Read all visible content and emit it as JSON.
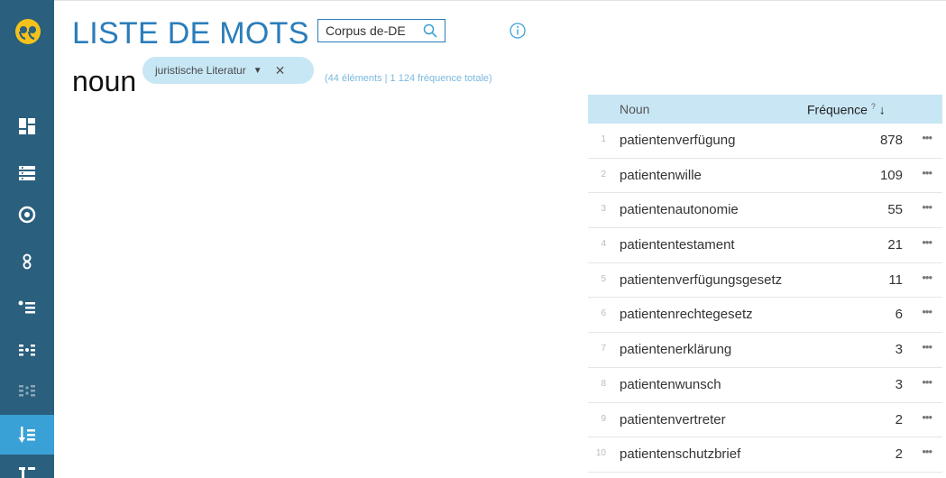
{
  "app": {
    "title": "LISTE DE MOTS"
  },
  "corpus": {
    "value": "Corpus de-DE"
  },
  "query": {
    "attribute": "noun",
    "filter_chip": "juristische Literatur",
    "summary": "(44 éléments | 1 124 fréquence totale)"
  },
  "sidebar": {
    "items": [
      {
        "icon": "dashboard-icon"
      },
      {
        "icon": "list-icon"
      },
      {
        "icon": "target-icon"
      },
      {
        "icon": "concordance-icon"
      },
      {
        "icon": "bullet-list-icon"
      },
      {
        "icon": "ngram-icon"
      },
      {
        "icon": "keywords-icon"
      },
      {
        "icon": "wordlist-icon",
        "active": true
      },
      {
        "icon": "more-icon"
      }
    ]
  },
  "table": {
    "headers": {
      "noun": "Noun",
      "frequency": "Fréquence",
      "frequency_help": "?",
      "sort": "↓"
    },
    "rows": [
      {
        "n": "1",
        "word": "patientenverfügung",
        "freq": "878"
      },
      {
        "n": "2",
        "word": "patientenwille",
        "freq": "109"
      },
      {
        "n": "3",
        "word": "patientenautonomie",
        "freq": "55"
      },
      {
        "n": "4",
        "word": "patiententestament",
        "freq": "21"
      },
      {
        "n": "5",
        "word": "patientenverfügungsgesetz",
        "freq": "11"
      },
      {
        "n": "6",
        "word": "patientenrechtegesetz",
        "freq": "6"
      },
      {
        "n": "7",
        "word": "patientenerklärung",
        "freq": "3"
      },
      {
        "n": "8",
        "word": "patientenwunsch",
        "freq": "3"
      },
      {
        "n": "9",
        "word": "patientenvertreter",
        "freq": "2"
      },
      {
        "n": "10",
        "word": "patientenschutzbrief",
        "freq": "2"
      }
    ],
    "row_menu": "•••"
  },
  "colors": {
    "sidebar": "#2a5f7d",
    "active": "#3aa1d6",
    "accent": "#2a7dba",
    "chip": "#c7e7f5",
    "header_row": "#c9e6f4"
  }
}
